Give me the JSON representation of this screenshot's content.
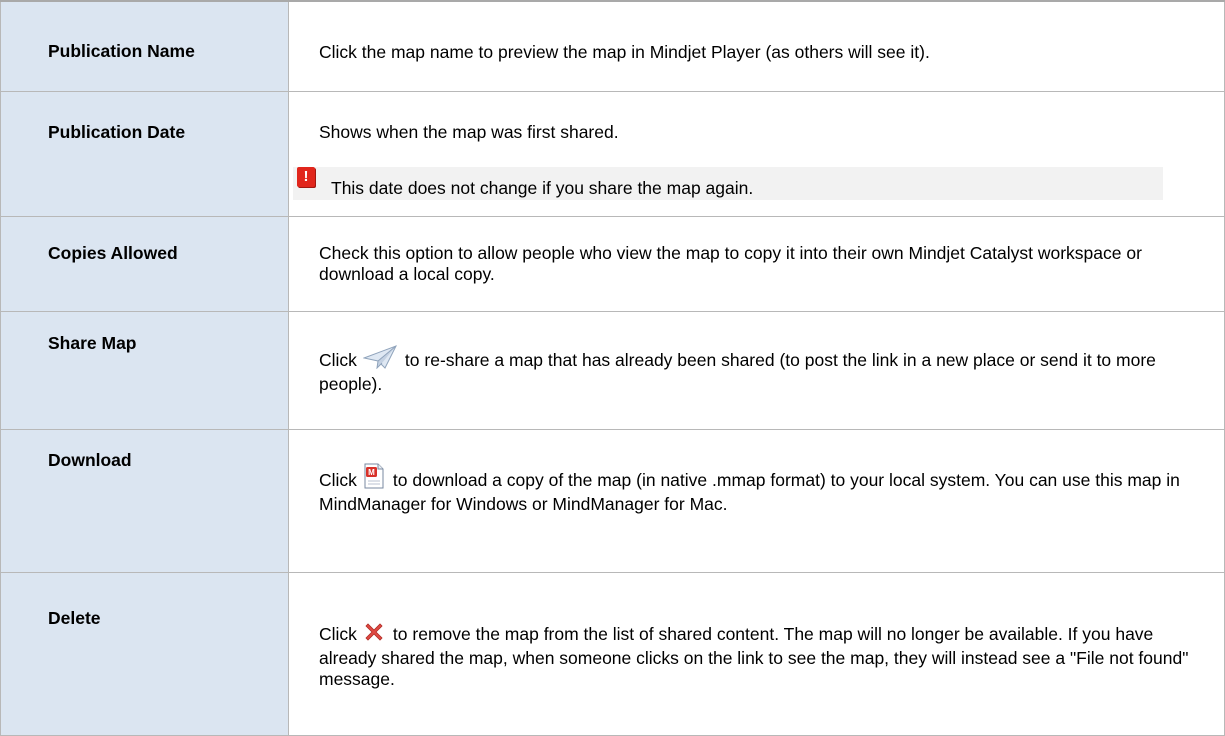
{
  "rows": [
    {
      "label": "Publication Name",
      "desc": "Click the map name to preview the map in Mindjet Player (as others will see it)."
    },
    {
      "label": "Publication Date",
      "desc": "Shows when the map was first shared.",
      "note": "This date does not change if you share the map again."
    },
    {
      "label": "Copies Allowed",
      "desc": "Check  this option to allow people who view the map to copy it into their own Mindjet Catalyst workspace or download a local copy."
    },
    {
      "label": "Share Map",
      "desc_before": "Click",
      "desc_after": "to  re-share a map  that has already been shared (to post the link in a new place or send it to more people).",
      "icon": "paper-plane-icon"
    },
    {
      "label": "Download",
      "desc_before": "Click",
      "desc_after": "to download a copy of the map (in native .mmap format) to your local system. You can use this map in MindManager for Windows or MindManager for Mac.",
      "icon": "mmap-file-icon"
    },
    {
      "label": "Delete",
      "desc_before": "Click",
      "desc_after": "to remove the map from the list of shared content. The map will no longer be available. If you have already shared the map, when someone clicks on the link to see the map, they will instead see a \"File not found\" message.",
      "icon": "red-x-icon"
    }
  ],
  "colors": {
    "label_bg": "#dbe5f1",
    "border": "#b8b8b8",
    "note_bg": "#f2f2f2",
    "warning_red": "#e1261c"
  }
}
